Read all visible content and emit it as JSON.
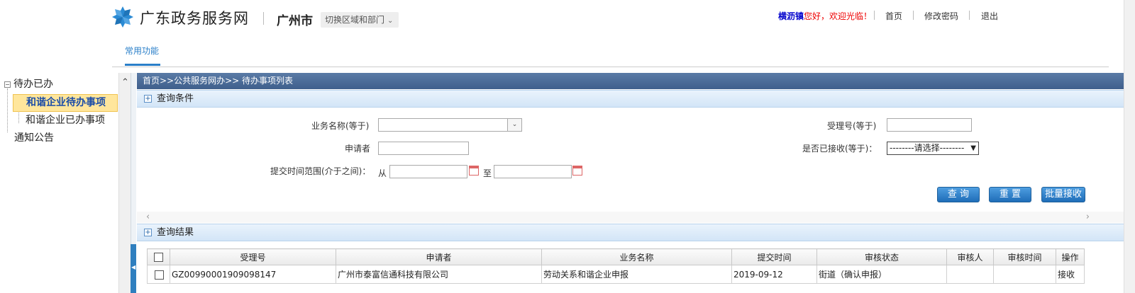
{
  "header": {
    "site_name": "广东政务服务网",
    "city": "广州市",
    "switch_region_label": "切换区域和部门",
    "welcome_user": "横沥镇",
    "welcome_message": "您好，欢迎光临！",
    "links": {
      "home": "首页",
      "change_password": "修改密码",
      "logout": "退出"
    },
    "nav_tab": "常用功能"
  },
  "tree": {
    "root": "待办已办",
    "children": [
      "和谐企业待办事项",
      "和谐企业已办事项"
    ],
    "other": "通知公告",
    "selected_index": 0
  },
  "main": {
    "breadcrumb": "首页>>公共服务网办>> 待办事项列表",
    "query_section_title": "查询条件",
    "result_section_title": "查询结果",
    "toggle_symbol": "+",
    "form": {
      "business_name_label": "业务名称(等于)",
      "business_name_value": "",
      "accept_no_label": "受理号(等于)",
      "accept_no_value": "",
      "applicant_label": "申请者",
      "applicant_value": "",
      "received_label": "是否已接收(等于)：",
      "received_selected": "--------请选择--------",
      "submit_time_label": "提交时间范围(介于之间)：",
      "from_label": "从",
      "to_label": "至",
      "from_value": "",
      "to_value": ""
    },
    "buttons": {
      "query": "查 询",
      "reset": "重 置",
      "batch_receive": "批量接收"
    }
  },
  "table": {
    "columns": [
      "受理号",
      "申请者",
      "业务名称",
      "提交时间",
      "审核状态",
      "审核人",
      "审核时间",
      "操作"
    ],
    "rows": [
      {
        "accept_no": "GZ00990001909098147",
        "applicant": "广州市泰富信通科技有限公司",
        "business_name": "劳动关系和谐企业申报",
        "submit_time": "2019-09-12",
        "review_status": "街道（确认申报）",
        "reviewer": "",
        "review_time": "",
        "action": "接收"
      }
    ]
  },
  "colors": {
    "accent": "#2a7fc9",
    "breadcrumb_bg": "#4a6b98",
    "selected_bg": "#ffe69c",
    "button_bg": "#2a7ac2",
    "welcome_user": "#0000cc",
    "welcome_message": "#ee0000"
  },
  "icons": {
    "logo": "snowflake-logo-icon",
    "chevron": "chevron-down-icon",
    "calendar": "calendar-icon",
    "scroll_up": "arrow-up-icon",
    "scroll_left": "arrow-left-icon",
    "scroll_right": "arrow-right-icon"
  }
}
